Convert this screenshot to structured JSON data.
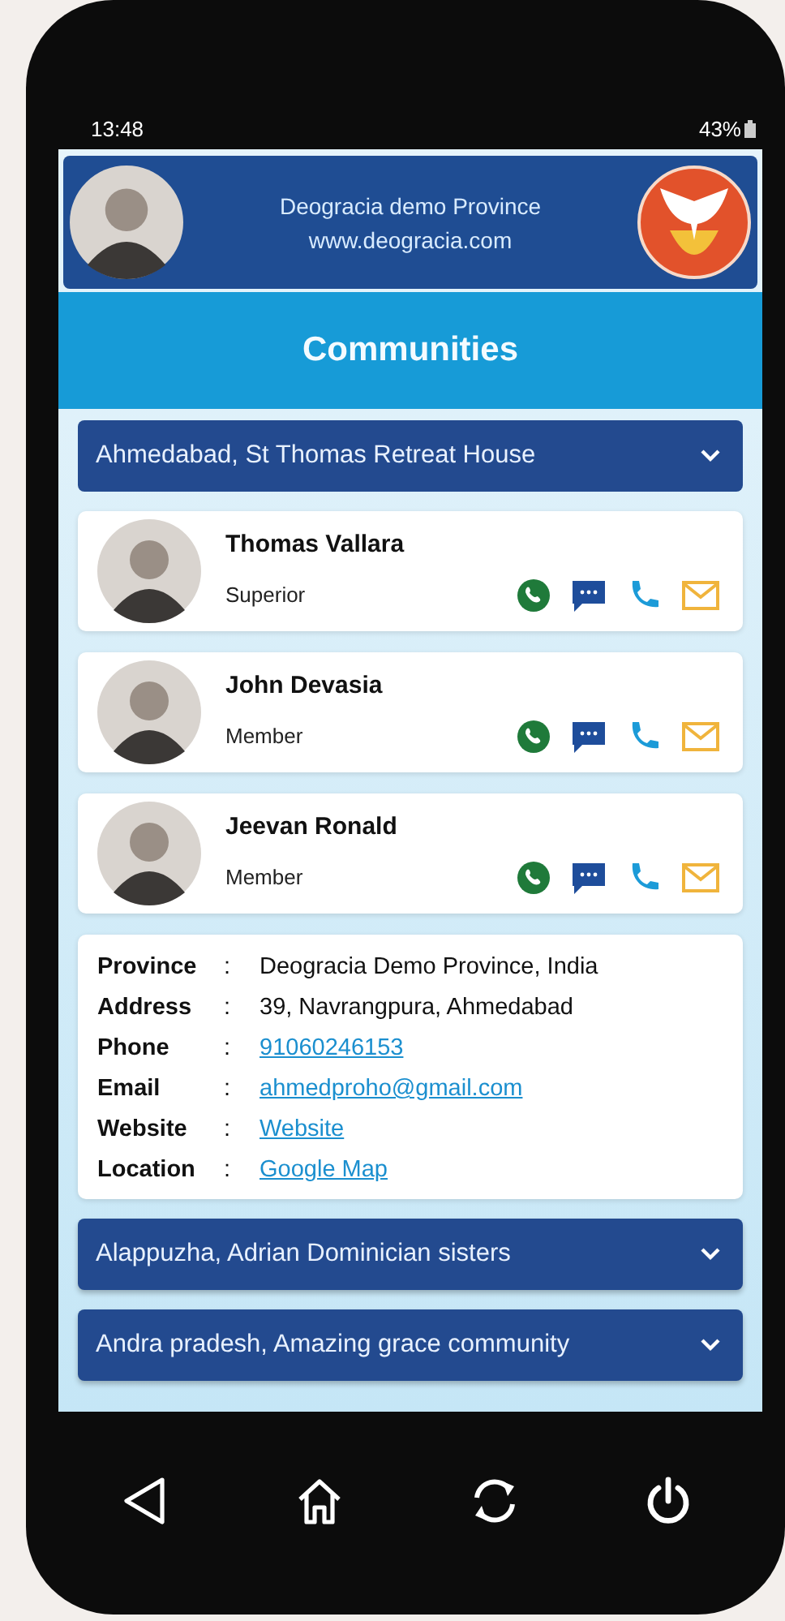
{
  "status_bar": {
    "time": "13:48",
    "battery": "43%"
  },
  "header": {
    "title": "Deogracia demo Province",
    "website": "www.deogracia.com"
  },
  "page_title": "Communities",
  "communities": [
    {
      "name": "Ahmedabad, St Thomas Retreat House",
      "expanded": true,
      "members": [
        {
          "name": "Thomas Vallara",
          "role": "Superior"
        },
        {
          "name": "John Devasia",
          "role": "Member"
        },
        {
          "name": "Jeevan Ronald",
          "role": "Member"
        }
      ],
      "details": [
        {
          "label": "Province",
          "separator": ":",
          "value": "Deogracia Demo Province, India",
          "kind": "text"
        },
        {
          "label": "Address",
          "separator": ":",
          "value": "39, Navrangpura, Ahmedabad",
          "kind": "text"
        },
        {
          "label": "Phone",
          "separator": ":",
          "value": "91060246153",
          "kind": "link"
        },
        {
          "label": "Email",
          "separator": ":",
          "value": "ahmedproho@gmail.com",
          "kind": "link"
        },
        {
          "label": "Website",
          "separator": ":",
          "value": "Website",
          "kind": "link"
        },
        {
          "label": "Location",
          "separator": ":",
          "value": "Google Map",
          "kind": "link"
        }
      ]
    },
    {
      "name": "Alappuzha, Adrian Dominician sisters",
      "expanded": false
    },
    {
      "name": "Andra pradesh, Amazing grace community",
      "expanded": false
    }
  ]
}
